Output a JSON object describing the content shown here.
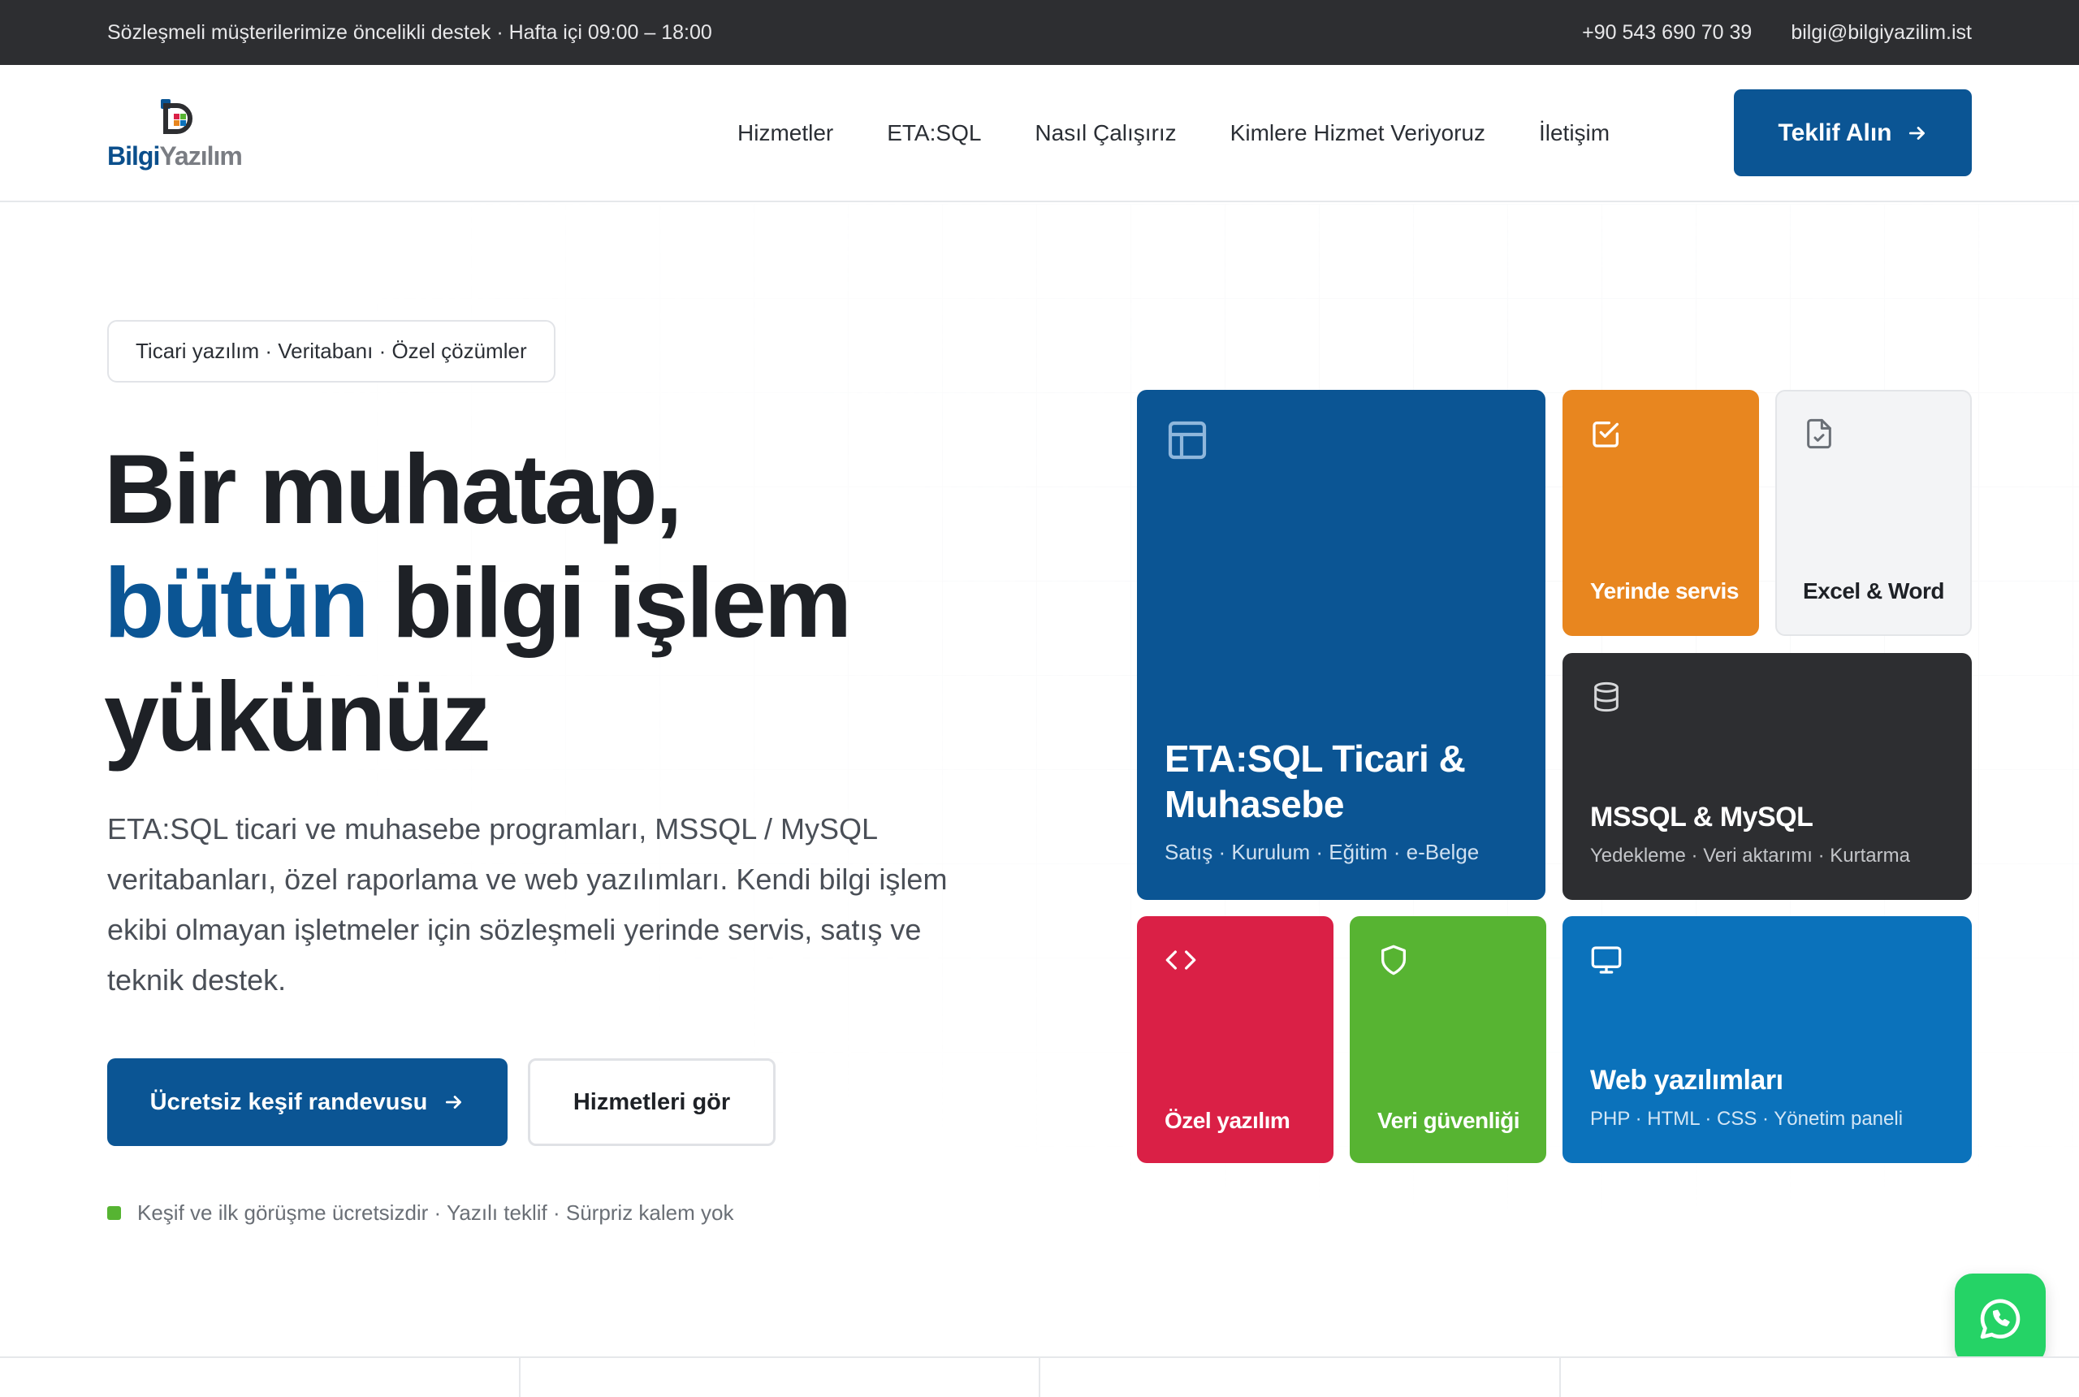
{
  "topbar": {
    "notice": "Sözleşmeli müşterilerimize öncelikli destek · Hafta içi 09:00 – 18:00",
    "phone": "+90 543 690 70 39",
    "email": "bilgi@bilgiyazilim.ist"
  },
  "logo": {
    "part1": "Bilgi",
    "part2": "Yazılım"
  },
  "nav": {
    "items": [
      "Hizmetler",
      "ETA:SQL",
      "Nasıl Çalışırız",
      "Kimlere Hizmet Veriyoruz",
      "İletişim"
    ],
    "cta": "Teklif Alın"
  },
  "hero": {
    "badge": "Ticari yazılım · Veritabanı · Özel çözümler",
    "headline_line1": "Bir muhatap,",
    "headline_accent": "bütün",
    "headline_line2_rest": " bilgi işlem",
    "headline_line3": "yükünüz",
    "lead": "ETA:SQL ticari ve muhasebe programları, MSSQL / MySQL veritabanları, özel raporlama ve web yazılımları. Kendi bilgi işlem ekibi olmayan işletmeler için sözleşmeli yerinde servis, satış ve teknik destek.",
    "primary_button": "Ücretsiz keşif randevusu",
    "secondary_button": "Hizmetleri gör",
    "note": "Keşif ve ilk görüşme ücretsizdir · Yazılı teklif · Sürpriz kalem yok"
  },
  "tiles": {
    "eta": {
      "title_line1": "ETA:SQL Ticari &",
      "title_line2": "Muhasebe",
      "subtitle": "Satış · Kurulum · Eğitim · e-Belge",
      "color": "#0b5594",
      "icon": "table-icon"
    },
    "yerinde": {
      "title": "Yerinde servis",
      "color": "#e8861f",
      "icon": "check-square-icon"
    },
    "excel": {
      "title": "Excel & Word",
      "color": "#f3f4f6",
      "icon": "file-check-icon"
    },
    "sql": {
      "title": "MSSQL & MySQL",
      "subtitle": "Yedekleme · Veri aktarımı · Kurtarma",
      "color": "#2d2e31",
      "icon": "database-icon"
    },
    "ozel": {
      "title": "Özel yazılım",
      "color": "#da2046",
      "icon": "code-icon"
    },
    "veri": {
      "title": "Veri güvenliği",
      "color": "#57b432",
      "icon": "shield-icon"
    },
    "web": {
      "title": "Web yazılımları",
      "subtitle": "PHP · HTML · CSS · Yönetim paneli",
      "color": "#0b72bb",
      "icon": "monitor-icon"
    }
  },
  "whatsapp": {
    "icon": "whatsapp-icon",
    "color": "#25d366"
  }
}
